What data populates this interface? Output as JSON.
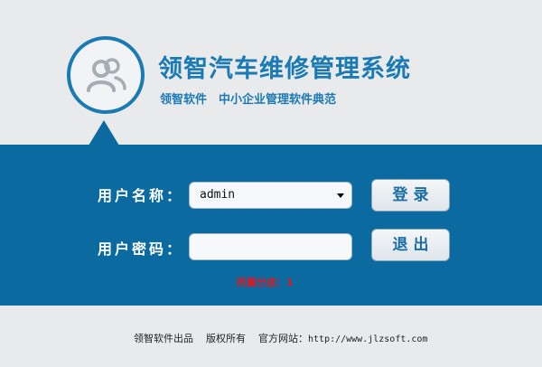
{
  "header": {
    "title": "领智汽车维修管理系统",
    "slogan": "领智软件　中小企业管理软件典范",
    "logo_icon": "users-icon"
  },
  "login": {
    "username_label": "用户名称：",
    "username_value": "admin",
    "password_label": "用户密码：",
    "password_value": "",
    "login_button": "登录",
    "exit_button": "退出",
    "branch_text": "所属分店：1"
  },
  "footer": {
    "publisher": "领智软件出品",
    "rights": "版权所有",
    "website_label": "官方网站：",
    "website_url": "http://www.jlzsoft.com"
  },
  "colors": {
    "brand_blue": "#1a7ab4",
    "band_blue": "#0b6aa0",
    "alert_red": "#e8141b"
  }
}
